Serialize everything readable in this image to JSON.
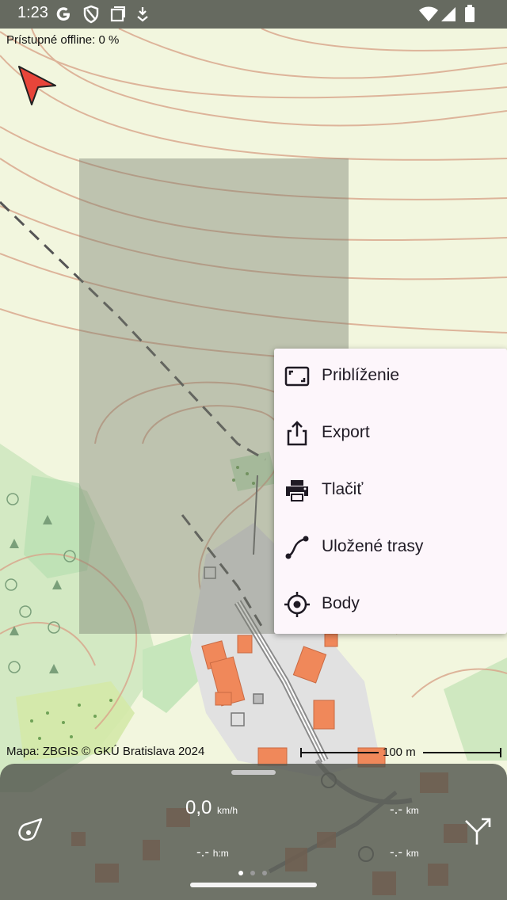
{
  "status_bar": {
    "time": "1:23",
    "left_icons": [
      "google-g-icon",
      "shield-icon",
      "window-icon",
      "download-icon"
    ],
    "right_icons": [
      "wifi-icon",
      "signal-icon",
      "battery-icon"
    ]
  },
  "map": {
    "offline_text": "Prístupné offline: 0 %",
    "attribution": "Mapa: ZBGIS © GKÚ Bratislava 2024",
    "scale_label": "100 m"
  },
  "context_menu": {
    "items": [
      {
        "label": "Priblíženie",
        "icon": "zoom-frame-icon"
      },
      {
        "label": "Export",
        "icon": "share-upload-icon"
      },
      {
        "label": "Tlačiť",
        "icon": "print-icon"
      },
      {
        "label": "Uložené trasy",
        "icon": "route-icon"
      },
      {
        "label": "Body",
        "icon": "crosshair-icon"
      }
    ]
  },
  "bottom_panel": {
    "speed_value": "0,0",
    "speed_unit": "km/h",
    "time_value": "-.-",
    "time_unit": "h:m",
    "distance1_value": "-.-",
    "distance1_unit": "km",
    "distance2_value": "-.-",
    "distance2_unit": "km",
    "page_indicator": {
      "total": 3,
      "active": 1
    }
  },
  "colors": {
    "map_background": "#f2f6de",
    "contour": "#d9a48a",
    "forest": "#cfe8c0",
    "building": "#f0885a",
    "menu_background": "#fdf6fb",
    "position_arrow": "#e8453a"
  }
}
